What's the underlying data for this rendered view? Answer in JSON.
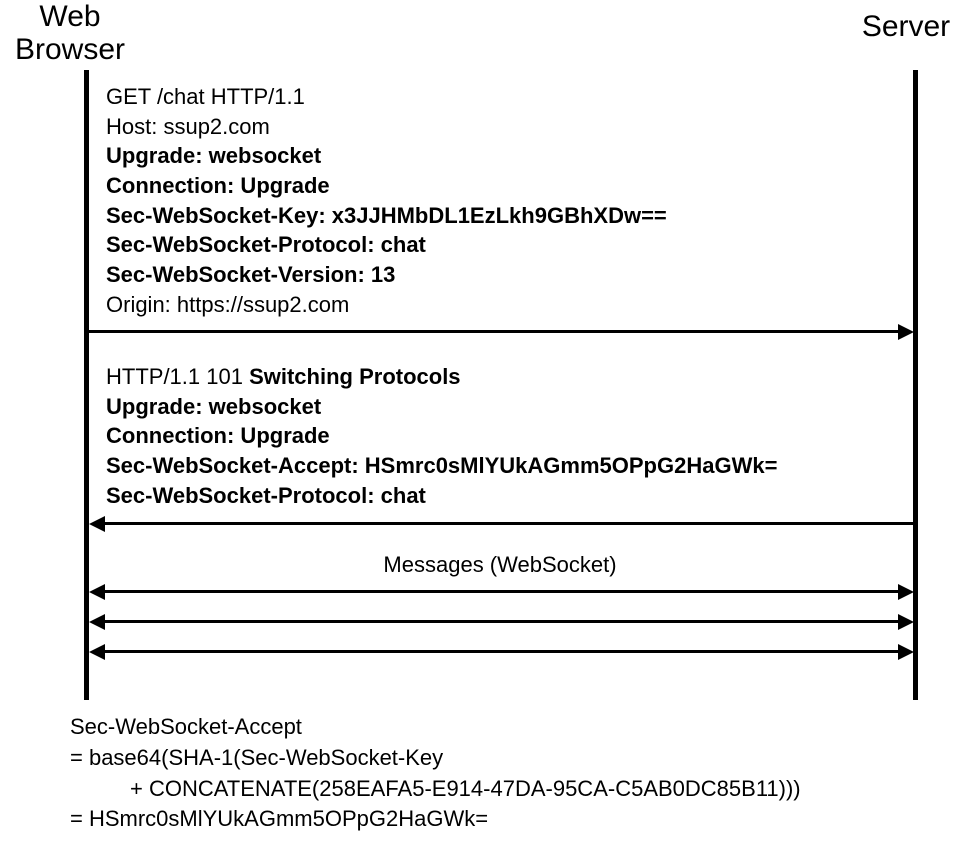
{
  "actors": {
    "client": "Web\nBrowser",
    "server": "Server"
  },
  "request": {
    "line1_a": "GET /chat HTTP/1.1",
    "line2_a": "Host: ssup2.com",
    "line3_b": "Upgrade: websocket",
    "line4_b": "Connection: Upgrade",
    "line5_b": "Sec-WebSocket-Key: x3JJHMbDL1EzLkh9GBhXDw==",
    "line6_b": "Sec-WebSocket-Protocol: chat",
    "line7_b": "Sec-WebSocket-Version: 13",
    "line8_a": "Origin: https://ssup2.com"
  },
  "response": {
    "line1_pre": "HTTP/1.1 101 ",
    "line1_bold": "Switching Protocols",
    "line2_b": "Upgrade: websocket",
    "line3_b": "Connection: Upgrade",
    "line4_b": "Sec-WebSocket-Accept: HSmrc0sMlYUkAGmm5OPpG2HaGWk=",
    "line5_b": "Sec-WebSocket-Protocol: chat"
  },
  "ws_label": "Messages (WebSocket)",
  "calc": {
    "l1": "Sec-WebSocket-Accept",
    "l2": "= base64(SHA-1(Sec-WebSocket-Key",
    "l3": "+ CONCATENATE(258EAFA5-E914-47DA-95CA-C5AB0DC85B11)))",
    "l4": "= HSmrc0sMlYUkAGmm5OPpG2HaGWk="
  }
}
